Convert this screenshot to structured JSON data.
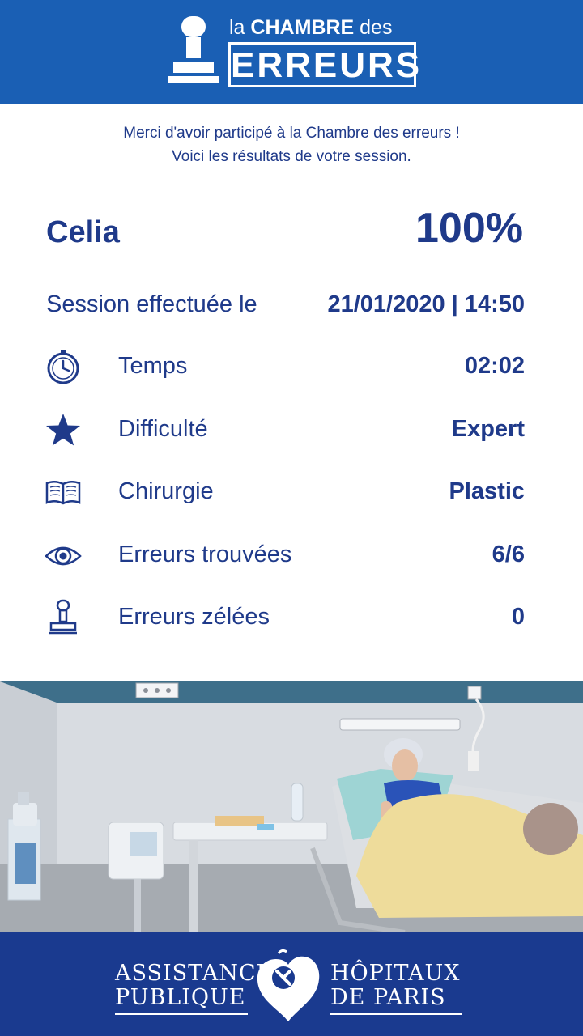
{
  "header": {
    "title_prefix": "la",
    "title_main": "CHAMBRE",
    "title_suffix": "des",
    "title_big": "ERREURS"
  },
  "intro": {
    "line1": "Merci d'avoir participé à la Chambre des erreurs !",
    "line2": "Voici les résultats de votre session."
  },
  "result": {
    "name": "Celia",
    "score": "100%"
  },
  "session": {
    "label": "Session effectuée le",
    "value": "21/01/2020 | 14:50"
  },
  "stats": [
    {
      "icon": "clock-icon",
      "label": "Temps",
      "value": "02:02"
    },
    {
      "icon": "star-icon",
      "label": "Difficulté",
      "value": "Expert"
    },
    {
      "icon": "book-icon",
      "label": "Chirurgie",
      "value": "Plastic"
    },
    {
      "icon": "eye-icon",
      "label": "Erreurs trouvées",
      "value": "6/6"
    },
    {
      "icon": "stamp-icon",
      "label": "Erreurs zélées",
      "value": "0"
    }
  ],
  "footer": {
    "left_line1": "ASSISTANCE",
    "left_line2": "PUBLIQUE",
    "right_line1": "HÔPITAUX",
    "right_line2": "DE PARIS"
  },
  "colors": {
    "brand_blue": "#1a5fb4",
    "footer_blue": "#1a3a8f",
    "text_blue": "#1f3a8a"
  }
}
